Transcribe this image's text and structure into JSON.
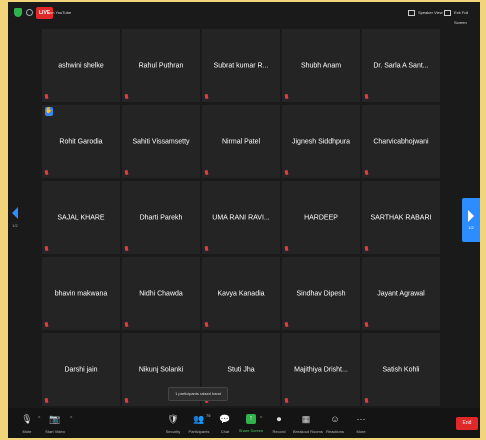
{
  "topbar": {
    "live_badge": "LIVE",
    "live_destination": "on YouTube",
    "speaker_view": "Speaker View",
    "exit_full_screen": "Exit Full Screen"
  },
  "gallery": {
    "page_left_label": "1/2",
    "page_right_label": "1/2",
    "participants": [
      "ashwini shelke",
      "Rahul Puthran",
      "Subrat kumar R...",
      "Shubh Anam",
      "Dr. Sarla A Sant...",
      "Rohit Garodia",
      "Sahiti Vissamsetty",
      "Nirmal Patel",
      "Jignesh Siddhpura",
      "Charvicabhojwani",
      "SAJAL KHARE",
      "Dharti Parekh",
      "UMA RANI RAVI...",
      "HARDEEP",
      "SARTHAK RABARI",
      "bhavin makwana",
      "Nidhi Chawda",
      "Kavya Kanadia",
      "Sindhav Dipesh",
      "Jayant Agrawal",
      "Darshi jain",
      "Nikunj Solanki",
      "Stuti Jha",
      "Majithiya Drisht...",
      "Satish Kohli"
    ],
    "raised_hand_icon": "hand-raise-icon",
    "muted_icon": "mic-muted-icon"
  },
  "toast": "1 participants raised hand",
  "toolbar": {
    "mute": "Mute",
    "start_video": "Start Video",
    "security": "Security",
    "participants": "Participants",
    "participant_count": "75",
    "chat": "Chat",
    "share_screen": "Share Screen",
    "record": "Record",
    "breakout_rooms": "Breakout Rooms",
    "reactions": "Reactions",
    "more": "More",
    "end": "End"
  },
  "colors": {
    "accent": "#2d8cff",
    "live": "#e02828",
    "share": "#2fb14c",
    "tile": "#242424",
    "frame": "#f2d57a"
  }
}
